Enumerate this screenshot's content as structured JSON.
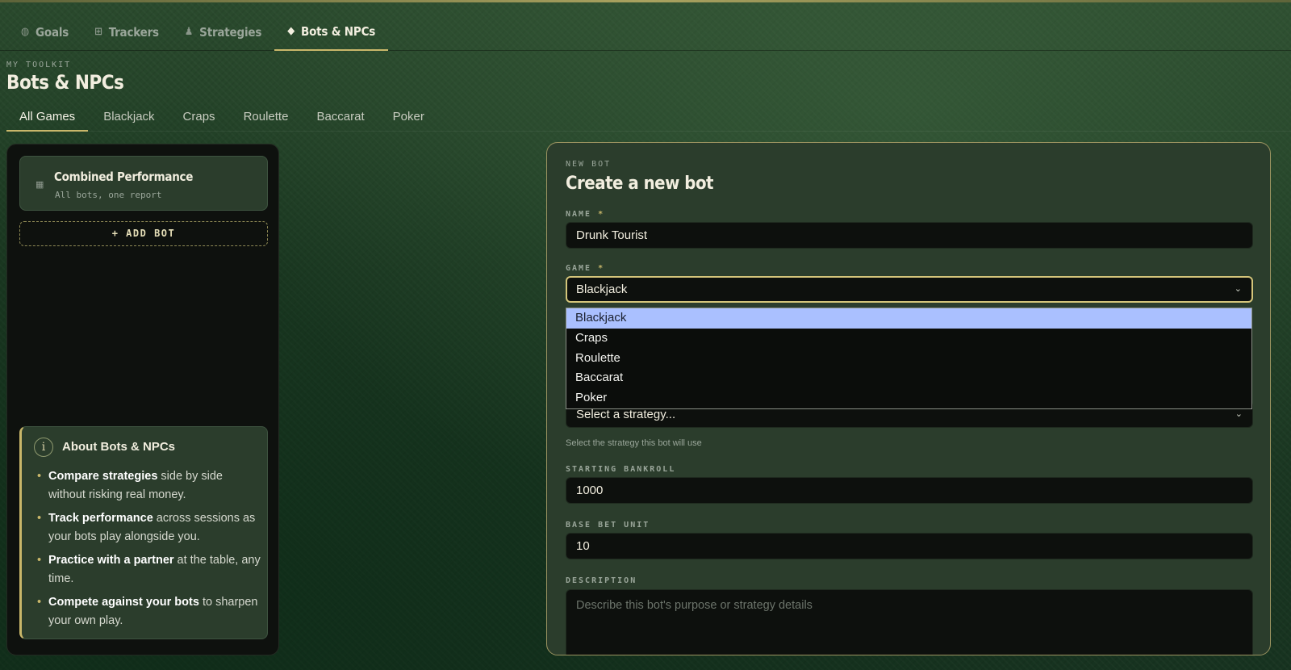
{
  "topnav": {
    "items": [
      {
        "label": "Goals",
        "icon": "goal-icon"
      },
      {
        "label": "Trackers",
        "icon": "grid-icon"
      },
      {
        "label": "Strategies",
        "icon": "person-icon"
      },
      {
        "label": "Bots & NPCs",
        "icon": "diamond-icon"
      }
    ],
    "active": "Bots & NPCs"
  },
  "header": {
    "eyebrow": "MY TOOLKIT",
    "title": "Bots & NPCs"
  },
  "game_tabs": {
    "items": [
      "All Games",
      "Blackjack",
      "Craps",
      "Roulette",
      "Baccarat",
      "Poker"
    ],
    "active": "All Games"
  },
  "sidebar": {
    "combined": {
      "title": "Combined Performance",
      "subtitle": "All bots, one report"
    },
    "add_bot_label": "+ ADD BOT",
    "about": {
      "title": "About Bots & NPCs",
      "items": [
        {
          "bold": "Compare strategies",
          "rest": " side by side without risking real money."
        },
        {
          "bold": "Track performance",
          "rest": " across sessions as your bots play alongside you."
        },
        {
          "bold": "Practice with a partner",
          "rest": " at the table, any time."
        },
        {
          "bold": "Compete against your bots",
          "rest": " to sharpen your own play."
        }
      ]
    }
  },
  "form": {
    "eyebrow": "NEW BOT",
    "title": "Create a new bot",
    "name_label": "NAME",
    "name_value": "Drunk Tourist",
    "game_label": "GAME",
    "game_value": "Blackjack",
    "game_options": [
      "Blackjack",
      "Craps",
      "Roulette",
      "Baccarat",
      "Poker"
    ],
    "strategy_value": "Select a strategy...",
    "strategy_hint": "Select the strategy this bot will use",
    "bankroll_label": "STARTING BANKROLL",
    "bankroll_value": "1000",
    "bet_label": "BASE BET UNIT",
    "bet_value": "10",
    "description_label": "DESCRIPTION",
    "description_placeholder": "Describe this bot's purpose or strategy details",
    "required_mark": "*"
  },
  "colors": {
    "accent_gold": "#c9b76a",
    "dropdown_selected": "#aac0ff",
    "panel_green": "#2b3d2c"
  }
}
